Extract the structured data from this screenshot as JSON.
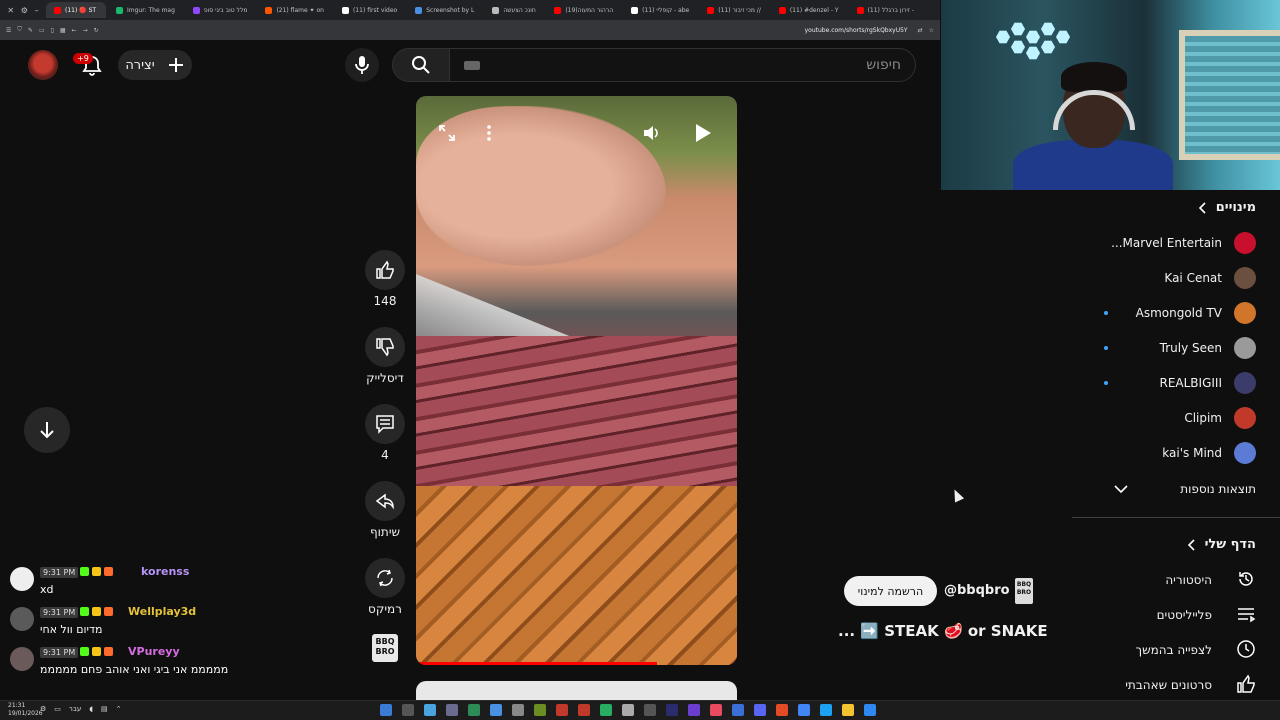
{
  "browser": {
    "tabs": [
      {
        "label": "(11) 🔴 ST",
        "color": "#ff0000",
        "active": true
      },
      {
        "label": "Imgur: The mag",
        "color": "#1bb76e"
      },
      {
        "label": "מלל טוב ביגי סופ",
        "color": "#9146ff"
      },
      {
        "label": "(21) flame ✦ on",
        "color": "#ff5500"
      },
      {
        "label": "(11) first video",
        "color": "#ffffff"
      },
      {
        "label": "Screenshot by L",
        "color": "#4a90e2"
      },
      {
        "label": "חונכ הצעשה",
        "color": "#bbbbbb"
      },
      {
        "label": "(19)הרהור המעוה",
        "color": "#ff0000"
      },
      {
        "label": "(11) קופליי - abe",
        "color": "#ffffff"
      },
      {
        "label": "(11) מכי זיבור //",
        "color": "#ff0000"
      },
      {
        "label": "(11) #denzel - Y",
        "color": "#ff0000"
      },
      {
        "label": "(11) זירון ברגלל -",
        "color": "#ff0000"
      }
    ],
    "url": "youtube.com/shorts/rgSkQbxyU5Y"
  },
  "header": {
    "notif_badge": "+9",
    "create_label": "יצירה",
    "search_placeholder": "חיפוש"
  },
  "actions": {
    "like_count": "148",
    "dislike_label": "דיסלייק",
    "comments_count": "4",
    "share_label": "שיתוף",
    "remix_label": "רמיקס",
    "channel_icon_text": "BBQ BRO"
  },
  "video": {
    "subscribe_label": "הרשמה למינוי",
    "handle": "@bbqbro",
    "title": "... ➡️ STEAK 🥩 or SNAKE",
    "progress": 0.75
  },
  "chat": [
    {
      "time": "9:31 PM",
      "user": "korenss",
      "user_color": "#b794f6",
      "text": "xd",
      "avatar_color": "#eeeeee"
    },
    {
      "time": "9:31 PM",
      "user": "Wellplay3d",
      "user_color": "#e4c23a",
      "text": "מדיום וול אחי",
      "avatar_color": "#5a5a5a"
    },
    {
      "time": "9:31 PM",
      "user": "VPureyy",
      "user_color": "#d56de0",
      "text": "מממממ אני ביגי ואני אוהב פחם מממממ",
      "avatar_color": "#6a5a5a"
    }
  ],
  "sidebar": {
    "subscriptions_title": "מינויים",
    "subscriptions": [
      {
        "name": "Marvel Entertain...",
        "avatar_color": "#c8102e",
        "live": false
      },
      {
        "name": "Kai Cenat",
        "avatar_color": "#6b5040",
        "live": false
      },
      {
        "name": "Asmongold TV",
        "avatar_color": "#d0752a",
        "live": true
      },
      {
        "name": "Truly Seen",
        "avatar_color": "#9a9a9a",
        "live": true
      },
      {
        "name": "REALBIGIII",
        "avatar_color": "#3c3c6a",
        "live": true
      },
      {
        "name": "Clipim",
        "avatar_color": "#c0392b",
        "live": false
      },
      {
        "name": "kai's Mind",
        "avatar_color": "#5b7bd5",
        "live": false
      }
    ],
    "show_more_label": "תוצאות נוספות",
    "you_title": "הדף שלי",
    "you_items": [
      {
        "label": "היסטוריה",
        "icon": "history-icon"
      },
      {
        "label": "פלייליסטים",
        "icon": "playlist-icon"
      },
      {
        "label": "לצפייה בהמשך",
        "icon": "clock-icon"
      },
      {
        "label": "סרטונים שאהבתי",
        "icon": "thumb-up-icon"
      }
    ]
  },
  "taskbar": {
    "time": "21:31",
    "date": "19/01/2026",
    "lang": "עבר"
  }
}
